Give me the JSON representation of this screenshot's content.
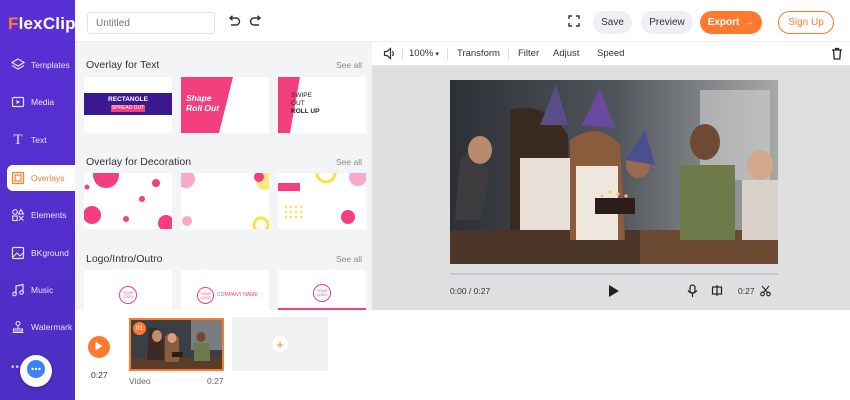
{
  "app": {
    "logo_first": "F",
    "logo_rest": "lexClip"
  },
  "header": {
    "title_placeholder": "Untitled",
    "save_label": "Save",
    "preview_label": "Preview",
    "export_label": "Export",
    "signup_label": "Sign Up"
  },
  "sidebar": {
    "items": [
      {
        "label": "Templates",
        "icon": "layers-icon"
      },
      {
        "label": "Media",
        "icon": "media-icon"
      },
      {
        "label": "Text",
        "icon": "text-icon"
      },
      {
        "label": "Overlays",
        "icon": "overlays-icon",
        "active": true
      },
      {
        "label": "Elements",
        "icon": "elements-icon"
      },
      {
        "label": "BKground",
        "icon": "background-icon"
      },
      {
        "label": "Music",
        "icon": "music-icon"
      },
      {
        "label": "Watermark",
        "icon": "watermark-icon"
      }
    ]
  },
  "panel": {
    "sections": [
      {
        "title": "Overlay for Text",
        "see_all": "See all",
        "cards": [
          {
            "line1": "RECTANGLE",
            "line2": "SPREAD OUT"
          },
          {
            "line1": "Shape",
            "line2": "Roll Out"
          },
          {
            "line1": "SWIPE",
            "line2": "OUT",
            "line3": "ROLL UP"
          }
        ]
      },
      {
        "title": "Overlay for Decoration",
        "see_all": "See all"
      },
      {
        "title": "Logo/Intro/Outro",
        "see_all": "See all",
        "cards": [
          {
            "logo": "YOUR LOGO"
          },
          {
            "logo": "YOUR LOGO",
            "company": "COMPANY NAME"
          },
          {
            "logo": "YOUR LOGO"
          }
        ]
      }
    ]
  },
  "toolbar": {
    "volume_icon": "speaker-icon",
    "zoom": "100%",
    "transform": "Transform",
    "filter": "Filter",
    "adjust": "Adjust",
    "speed": "Speed"
  },
  "player": {
    "current_time": "0:00 / 0:27",
    "duration": "0:27",
    "progress": 0
  },
  "timeline": {
    "total_time": "0:27",
    "clip": {
      "badge": "01",
      "label": "Video",
      "duration": "0:27"
    },
    "add_label": "+"
  },
  "colors": {
    "accent": "#ff7a2f",
    "sidebar": "#5b2fd6",
    "pink": "#f43f7f"
  }
}
